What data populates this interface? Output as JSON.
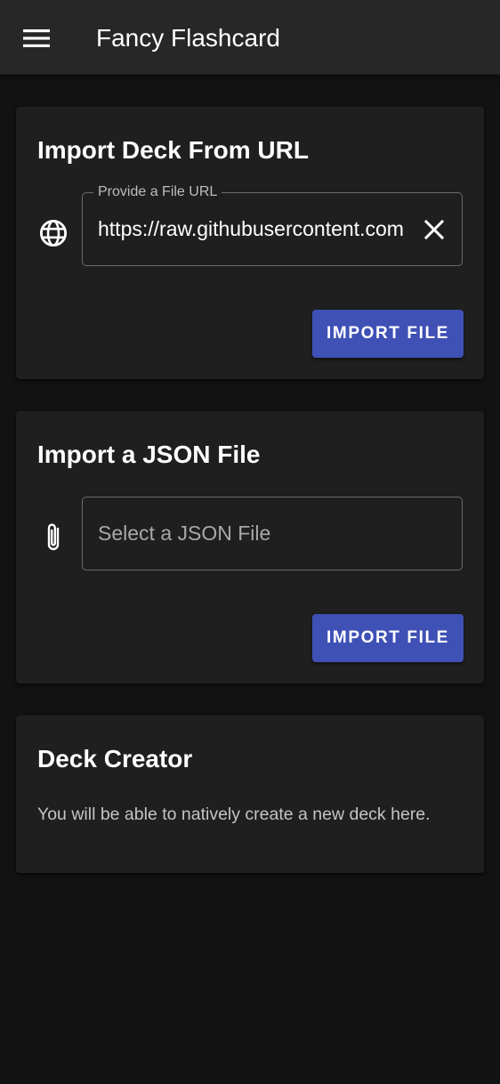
{
  "app_bar": {
    "title": "Fancy Flashcard",
    "menu_icon": "menu-icon"
  },
  "url_import": {
    "title": "Import Deck From URL",
    "icon": "globe-icon",
    "field_label": "Provide a File URL",
    "field_value": "https://raw.githubusercontent.com",
    "clear_icon": "close-icon",
    "button_label": "IMPORT FILE"
  },
  "json_import": {
    "title": "Import a JSON File",
    "icon": "paperclip-icon",
    "field_placeholder": "Select a JSON File",
    "button_label": "IMPORT FILE"
  },
  "deck_creator": {
    "title": "Deck Creator",
    "text": "You will be able to natively create a new deck here."
  },
  "colors": {
    "background": "#121212",
    "app_bar": "#272727",
    "card": "#1f1f1f",
    "primary_button": "#3f51b5"
  }
}
